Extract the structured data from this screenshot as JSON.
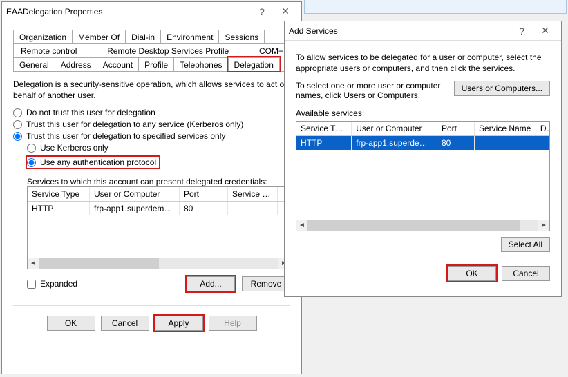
{
  "propsDialog": {
    "title": "EAADelegation Properties",
    "tabsRow1": [
      "Organization",
      "Member Of",
      "Dial-in",
      "Environment",
      "Sessions"
    ],
    "tabsRow2": [
      "Remote control",
      "Remote Desktop Services Profile",
      "COM+"
    ],
    "tabsRow3": [
      "General",
      "Address",
      "Account",
      "Profile",
      "Telephones",
      "Delegation"
    ],
    "desc": "Delegation is a security-sensitive operation, which allows services to act on behalf of another user.",
    "radio1": "Do not trust this user for delegation",
    "radio2": "Trust this user for delegation to any service (Kerberos only)",
    "radio3": "Trust this user for delegation to specified services only",
    "sub1": "Use Kerberos only",
    "sub2": "Use any authentication protocol",
    "servicesLabel": "Services to which this account can present delegated credentials:",
    "cols": {
      "svc": "Service Type",
      "uc": "User or Computer",
      "port": "Port",
      "sname": "Service N..."
    },
    "row": {
      "svc": "HTTP",
      "uc": "frp-app1.superdemo.l...",
      "port": "80",
      "sname": ""
    },
    "expanded": "Expanded",
    "addBtn": "Add...",
    "removeBtn": "Remove",
    "ok": "OK",
    "cancel": "Cancel",
    "apply": "Apply",
    "help": "Help"
  },
  "addDialog": {
    "title": "Add Services",
    "intro": "To allow services to be delegated for a user or computer, select the appropriate users or computers, and then click the services.",
    "selectText": "To select one or more user or computer names, click Users or Computers.",
    "usersBtn": "Users or Computers...",
    "availLabel": "Available services:",
    "cols": {
      "svc": "Service Type",
      "uc": "User or Computer",
      "port": "Port",
      "sname": "Service Name",
      "d": "D"
    },
    "row": {
      "svc": "HTTP",
      "uc": "frp-app1.superdemo.l...",
      "port": "80",
      "sname": "",
      "d": ""
    },
    "selectAll": "Select All",
    "ok": "OK",
    "cancel": "Cancel"
  }
}
